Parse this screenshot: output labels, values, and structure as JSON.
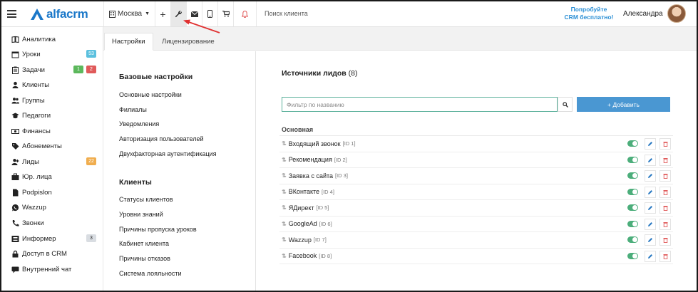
{
  "topbar": {
    "logo_text": "alfacrm",
    "city": "Москва",
    "search_placeholder": "Поиск клиента",
    "promo": [
      "Попробуйте",
      "CRM бесплатно!"
    ],
    "user_name": "Александра"
  },
  "sidebar": {
    "items": [
      {
        "label": "Аналитика",
        "icon": "book-icon"
      },
      {
        "label": "Уроки",
        "icon": "calendar-icon",
        "badges": [
          {
            "text": "53",
            "color": "#5bc0de"
          }
        ]
      },
      {
        "label": "Задачи",
        "icon": "clipboard-icon",
        "badges": [
          {
            "text": "1",
            "color": "#5cb85c"
          },
          {
            "text": "2",
            "color": "#e05a5a"
          }
        ]
      },
      {
        "label": "Клиенты",
        "icon": "user-icon"
      },
      {
        "label": "Группы",
        "icon": "users-icon"
      },
      {
        "label": "Педагоги",
        "icon": "graduation-cap-icon"
      },
      {
        "label": "Финансы",
        "icon": "money-icon"
      },
      {
        "label": "Абонементы",
        "icon": "tag-icon"
      },
      {
        "label": "Лиды",
        "icon": "user-plus-icon",
        "badges": [
          {
            "text": "22",
            "color": "#f0ad4e"
          }
        ]
      },
      {
        "label": "Юр. лица",
        "icon": "briefcase-icon"
      },
      {
        "label": "Podpislon",
        "icon": "file-icon"
      },
      {
        "label": "Wazzup",
        "icon": "whatsapp-icon"
      },
      {
        "label": "Звонки",
        "icon": "phone-icon"
      },
      {
        "label": "Информер",
        "icon": "list-icon",
        "badges": [
          {
            "text": "3",
            "color": "#d9dde2",
            "text_color": "#333"
          }
        ]
      },
      {
        "label": "Доступ в CRM",
        "icon": "lock-icon"
      },
      {
        "label": "Внутренний чат",
        "icon": "chat-icon"
      }
    ]
  },
  "tabs": [
    {
      "label": "Настройки",
      "active": true
    },
    {
      "label": "Лицензирование",
      "active": false
    }
  ],
  "settings_menu": {
    "sections": [
      {
        "title": "Базовые настройки",
        "links": [
          "Основные настройки",
          "Филиалы",
          "Уведомления",
          "Авторизация пользователей",
          "Двухфакторная аутентификация"
        ]
      },
      {
        "title": "Клиенты",
        "links": [
          "Статусы клиентов",
          "Уровни знаний",
          "Причины пропуска уроков",
          "Кабинет клиента",
          "Причины отказов",
          "Система лояльности"
        ]
      }
    ]
  },
  "lead_sources": {
    "title": "Источники лидов",
    "count": "(8)",
    "filter_placeholder": "Фильтр по названию",
    "add_label": "+ Добавить",
    "group": "Основная",
    "items": [
      {
        "name": "Входящий звонок",
        "id": "[ID 1]",
        "enabled": true
      },
      {
        "name": "Рекомендация",
        "id": "[ID 2]",
        "enabled": true
      },
      {
        "name": "Заявка с сайта",
        "id": "[ID 3]",
        "enabled": true
      },
      {
        "name": "ВКонтакте",
        "id": "[ID 4]",
        "enabled": true
      },
      {
        "name": "ЯДирект",
        "id": "[ID 5]",
        "enabled": true
      },
      {
        "name": "GoogleAd",
        "id": "[ID 6]",
        "enabled": true
      },
      {
        "name": "Wazzup",
        "id": "[ID 7]",
        "enabled": true
      },
      {
        "name": "Facebook",
        "id": "[ID 8]",
        "enabled": true
      }
    ]
  },
  "colors": {
    "brand": "#1b78c9",
    "toggle_on": "#4cae7b",
    "add_button": "#4a97d2",
    "edit_icon": "#2b7ac2",
    "delete_icon": "#e05a5a",
    "annotation_arrow": "#e03030"
  }
}
